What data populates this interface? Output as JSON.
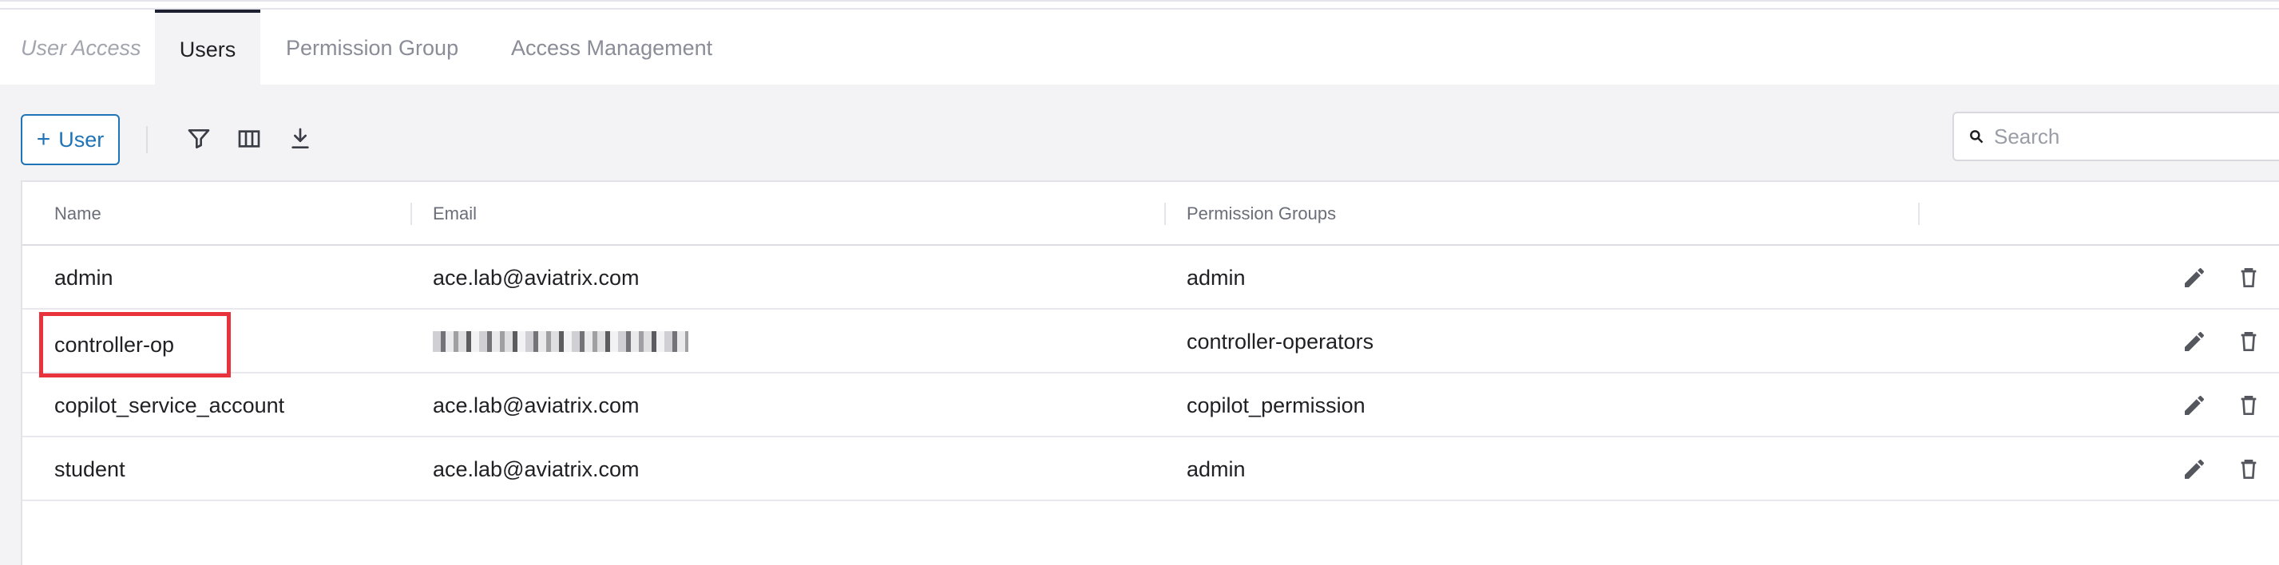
{
  "tabs": {
    "breadcrumb": "User Access",
    "items": [
      {
        "label": "Users",
        "active": true
      },
      {
        "label": "Permission Group",
        "active": false
      },
      {
        "label": "Access Management",
        "active": false
      }
    ]
  },
  "toolbar": {
    "add_plus": "+",
    "add_label": "User",
    "filter_icon": "filter-icon",
    "columns_icon": "columns-icon",
    "download_icon": "download-icon"
  },
  "search": {
    "placeholder": "Search",
    "value": ""
  },
  "table": {
    "columns": [
      "Name",
      "Email",
      "Permission Groups",
      ""
    ],
    "rows": [
      {
        "name": "admin",
        "email": "ace.lab@aviatrix.com",
        "groups": "admin",
        "email_redacted": false
      },
      {
        "name": "controller-op",
        "email": "",
        "groups": "controller-operators",
        "email_redacted": true,
        "highlighted": true
      },
      {
        "name": "copilot_service_account",
        "email": "ace.lab@aviatrix.com",
        "groups": "copilot_permission",
        "email_redacted": false
      },
      {
        "name": "student",
        "email": "ace.lab@aviatrix.com",
        "groups": "admin",
        "email_redacted": false
      }
    ],
    "row_actions": [
      "edit-icon",
      "delete-icon"
    ]
  },
  "colors": {
    "accent": "#1f73b7",
    "highlight": "#e8323c",
    "active_tab_border": "#1d2030"
  }
}
